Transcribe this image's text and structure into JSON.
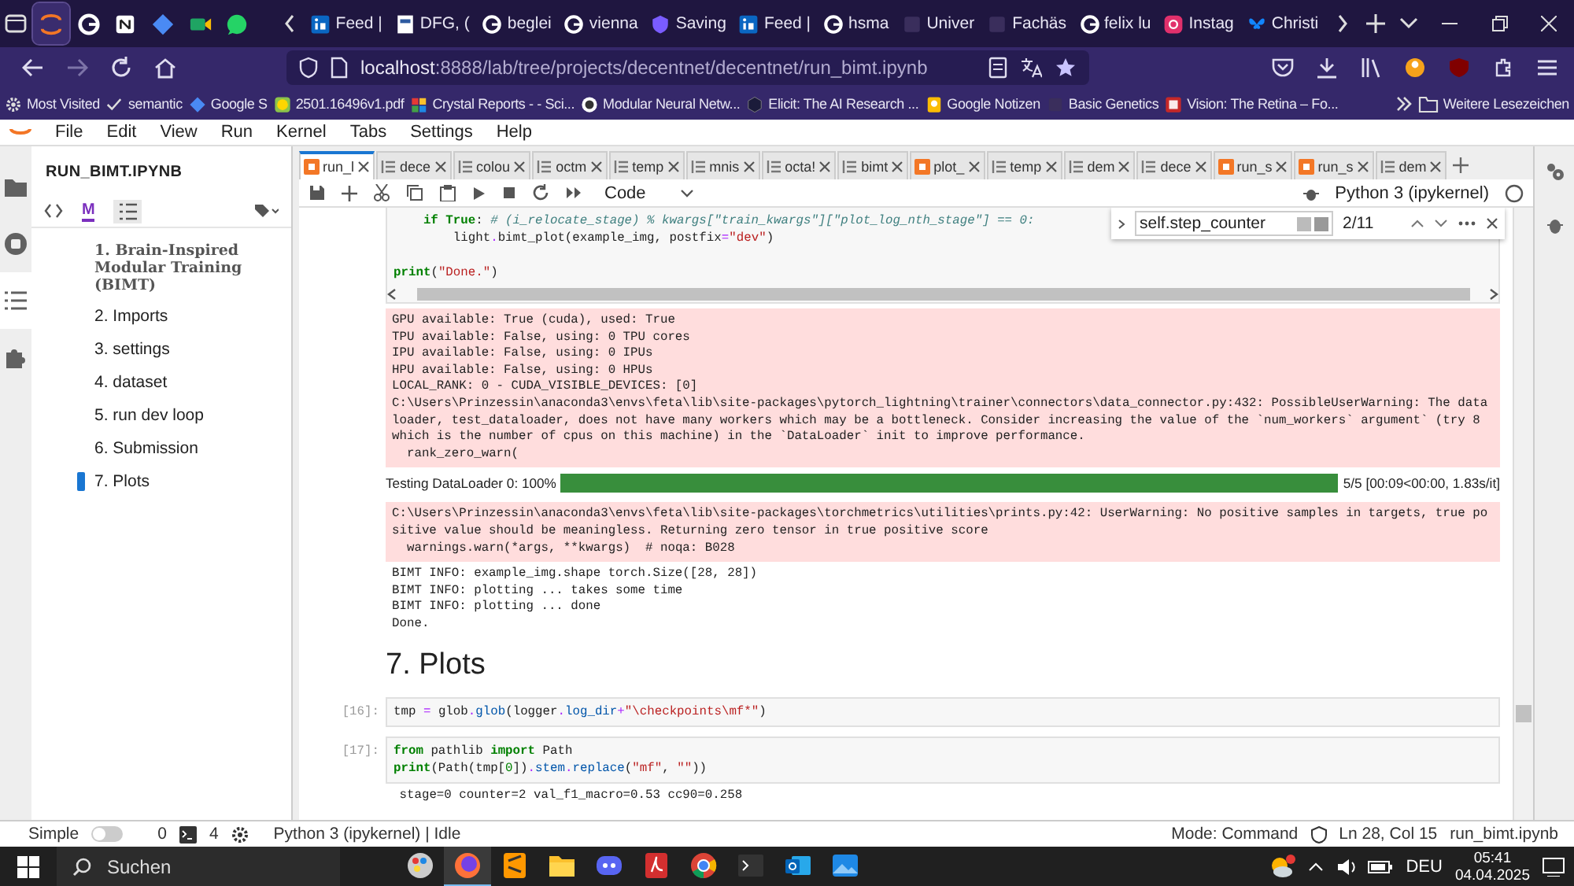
{
  "browser": {
    "pinned_tabs": [
      {
        "kind": "jupyter",
        "selected": true
      },
      {
        "kind": "google",
        "selected": false
      },
      {
        "kind": "notion",
        "selected": false
      },
      {
        "kind": "diamond",
        "selected": false
      },
      {
        "kind": "meet",
        "selected": false
      },
      {
        "kind": "whatsapp",
        "selected": false
      }
    ],
    "tabs": [
      {
        "label": "Feed |",
        "kind": "linkedin",
        "selected": false
      },
      {
        "label": "DFG, (",
        "kind": "dfg",
        "selected": false
      },
      {
        "label": "beglei",
        "kind": "google",
        "selected": false
      },
      {
        "label": "vienna",
        "kind": "google",
        "selected": false
      },
      {
        "label": "Saving",
        "kind": "stripe",
        "selected": false
      },
      {
        "label": "Feed |",
        "kind": "linkedin",
        "selected": false
      },
      {
        "label": "hsma",
        "kind": "google",
        "selected": false
      },
      {
        "label": "Univer",
        "kind": "dark",
        "selected": false
      },
      {
        "label": "Fachäs",
        "kind": "dark",
        "selected": false
      },
      {
        "label": "felix lu",
        "kind": "google",
        "selected": false
      },
      {
        "label": "Instag",
        "kind": "instagram",
        "selected": false
      },
      {
        "label": "Christi",
        "kind": "bluesky",
        "selected": false
      }
    ],
    "url": {
      "host": "localhost",
      "path": ":8888/lab/tree/projects/decentnet/decentnet/run_bimt.ipynb"
    },
    "bookmarks": [
      {
        "label": "Most Visited",
        "kind": "gear"
      },
      {
        "label": "semantic",
        "kind": "check"
      },
      {
        "label": "Google S",
        "kind": "diamond"
      },
      {
        "label": "2501.16496v1.pdf",
        "kind": "smile"
      },
      {
        "label": "Crystal Reports - - Sci...",
        "kind": "crystal"
      },
      {
        "label": "Modular Neural Netw...",
        "kind": "github"
      },
      {
        "label": "Elicit: The AI Research ...",
        "kind": "elicit"
      },
      {
        "label": "Google Notizen",
        "kind": "keep"
      },
      {
        "label": "Basic Genetics",
        "kind": "dark"
      },
      {
        "label": "Vision: The Retina – Fo...",
        "kind": "pb"
      }
    ],
    "bookmarks_more": "Weitere Lesezeichen"
  },
  "jupyter": {
    "menu": [
      "File",
      "Edit",
      "View",
      "Run",
      "Kernel",
      "Tabs",
      "Settings",
      "Help"
    ],
    "activity_bar": [
      {
        "kind": "folder",
        "selected": false
      },
      {
        "kind": "running",
        "selected": false
      },
      {
        "kind": "toc",
        "selected": true
      },
      {
        "kind": "extension",
        "selected": false
      }
    ],
    "sidebar": {
      "title": "RUN_BIMT.IPYNB",
      "markdown_toggle": "M",
      "toc": [
        {
          "label": "1. Brain-Inspired Modular Training (BIMT)",
          "bold": true,
          "selected": false
        },
        {
          "label": "2. Imports",
          "bold": false,
          "selected": false
        },
        {
          "label": "3. settings",
          "bold": false,
          "selected": false
        },
        {
          "label": "4. dataset",
          "bold": false,
          "selected": false
        },
        {
          "label": "5. run dev loop",
          "bold": false,
          "selected": false
        },
        {
          "label": "6. Submission",
          "bold": false,
          "selected": false
        },
        {
          "label": "7. Plots",
          "bold": false,
          "selected": true
        }
      ]
    },
    "tabs": [
      {
        "label": "run_l",
        "kind": "notebook",
        "selected": true
      },
      {
        "label": "dece",
        "kind": "file",
        "selected": false
      },
      {
        "label": "colou",
        "kind": "file",
        "selected": false
      },
      {
        "label": "octm",
        "kind": "file",
        "selected": false
      },
      {
        "label": "temp",
        "kind": "file",
        "selected": false
      },
      {
        "label": "mnis",
        "kind": "file",
        "selected": false
      },
      {
        "label": "octa!",
        "kind": "file",
        "selected": false
      },
      {
        "label": "bimt",
        "kind": "file",
        "selected": false
      },
      {
        "label": "plot_",
        "kind": "notebook",
        "selected": false
      },
      {
        "label": "temp",
        "kind": "file",
        "selected": false
      },
      {
        "label": "dem",
        "kind": "file",
        "selected": false
      },
      {
        "label": "dece",
        "kind": "file",
        "selected": false
      },
      {
        "label": "run_s",
        "kind": "notebook",
        "selected": false
      },
      {
        "label": "run_s",
        "kind": "notebook",
        "selected": false
      },
      {
        "label": "dem",
        "kind": "file",
        "selected": false
      }
    ],
    "cell_type": "Code",
    "kernel": "Python 3 (ipykernel)",
    "find": {
      "value": "self.step_counter",
      "count": "2/11"
    },
    "cells": [
      {
        "kind": "code",
        "blocks": [
          {
            "lines": [
              {
                "tokens": [
                  {
                    "kind": "keyword",
                    "text": "    if True"
                  },
                  {
                    "kind": "plain",
                    "text": ": "
                  },
                  {
                    "kind": "comment",
                    "text": "# (i_relocate_stage) % kwargs[\"train_kwargs\"][\"plot_log_nth_stage\"] == 0:"
                  }
                ]
              },
              {
                "tokens": [
                  {
                    "kind": "plain",
                    "text": "        light"
                  },
                  {
                    "kind": "operator",
                    "text": "."
                  },
                  {
                    "kind": "plain",
                    "text": "bimt_plot(example_img, postfix"
                  },
                  {
                    "kind": "operator",
                    "text": "="
                  },
                  {
                    "kind": "string",
                    "text": "\"dev\""
                  },
                  {
                    "kind": "plain",
                    "text": ")"
                  }
                ]
              }
            ]
          },
          {
            "lines": [
              {
                "tokens": [
                  {
                    "kind": "keyword",
                    "text": "print"
                  },
                  {
                    "kind": "plain",
                    "text": "("
                  },
                  {
                    "kind": "string",
                    "text": "\"Done.\""
                  },
                  {
                    "kind": "plain",
                    "text": ")"
                  }
                ]
              }
            ]
          }
        ],
        "outputs": [
          {
            "kind": "stderr",
            "lines": [
              "GPU available: True (cuda), used: True",
              "TPU available: False, using: 0 TPU cores",
              "IPU available: False, using: 0 IPUs",
              "HPU available: False, using: 0 HPUs",
              "LOCAL_RANK: 0 - CUDA_VISIBLE_DEVICES: [0]",
              "C:\\Users\\Prinzessin\\anaconda3\\envs\\feta\\lib\\site-packages\\pytorch_lightning\\trainer\\connectors\\data_connector.py:432: PossibleUserWarning: The dataloader, test_dataloader, does not have many workers which may be a bottleneck. Consider increasing the value of the `num_workers` argument` (try 8 which is the number of cpus on this machine) in the `DataLoader` init to improve performance.",
              "  rank_zero_warn("
            ]
          },
          {
            "kind": "progress",
            "label": "Testing DataLoader 0: 100%",
            "level": 1.0,
            "reading": "5/5 [00:09<00:00, 1.83s/it]"
          },
          {
            "kind": "stderr",
            "lines": [
              "C:\\Users\\Prinzessin\\anaconda3\\envs\\feta\\lib\\site-packages\\torchmetrics\\utilities\\prints.py:42: UserWarning: No positive samples in targets, true positive value should be meaningless. Returning zero tensor in true positive score",
              "  warnings.warn(*args, **kwargs)  # noqa: B028"
            ]
          },
          {
            "kind": "stdout",
            "lines": [
              "BIMT INFO: example_img.shape torch.Size([28, 28])",
              "BIMT INFO: plotting ... takes some time",
              "BIMT INFO: plotting ... done",
              "Done."
            ]
          }
        ]
      },
      {
        "kind": "heading",
        "text": "7. Plots"
      },
      {
        "kind": "code",
        "prompt": "[16]:",
        "blocks": [
          {
            "lines": [
              {
                "tokens": [
                  {
                    "kind": "plain",
                    "text": "tmp "
                  },
                  {
                    "kind": "operator",
                    "text": "="
                  },
                  {
                    "kind": "plain",
                    "text": " glob"
                  },
                  {
                    "kind": "operator",
                    "text": "."
                  },
                  {
                    "kind": "name",
                    "text": "glob"
                  },
                  {
                    "kind": "plain",
                    "text": "(logger"
                  },
                  {
                    "kind": "operator",
                    "text": "."
                  },
                  {
                    "kind": "name",
                    "text": "log_dir"
                  },
                  {
                    "kind": "operator",
                    "text": "+"
                  },
                  {
                    "kind": "string",
                    "text": "\"\\checkpoints\\mf*\""
                  },
                  {
                    "kind": "plain",
                    "text": ")"
                  }
                ]
              }
            ]
          }
        ]
      },
      {
        "kind": "code",
        "prompt": "[17]:",
        "blocks": [
          {
            "lines": [
              {
                "tokens": [
                  {
                    "kind": "keyword",
                    "text": "from"
                  },
                  {
                    "kind": "plain",
                    "text": " pathlib "
                  },
                  {
                    "kind": "keyword",
                    "text": "import"
                  },
                  {
                    "kind": "plain",
                    "text": " Path"
                  }
                ]
              },
              {
                "tokens": [
                  {
                    "kind": "keyword",
                    "text": "print"
                  },
                  {
                    "kind": "plain",
                    "text": "(Path(tmp["
                  },
                  {
                    "kind": "number",
                    "text": "0"
                  },
                  {
                    "kind": "plain",
                    "text": "])"
                  },
                  {
                    "kind": "operator",
                    "text": "."
                  },
                  {
                    "kind": "name",
                    "text": "stem"
                  },
                  {
                    "kind": "operator",
                    "text": "."
                  },
                  {
                    "kind": "name",
                    "text": "replace"
                  },
                  {
                    "kind": "plain",
                    "text": "("
                  },
                  {
                    "kind": "string",
                    "text": "\"mf\""
                  },
                  {
                    "kind": "plain",
                    "text": ", "
                  },
                  {
                    "kind": "string",
                    "text": "\"\""
                  },
                  {
                    "kind": "plain",
                    "text": "))"
                  }
                ]
              }
            ]
          }
        ],
        "outputs": [
          {
            "kind": "stdout",
            "lines": [
              " stage=0 counter=2 val_f1_macro=0.53 cc90=0.258"
            ]
          }
        ]
      }
    ],
    "status_bar": {
      "simple_label": "Simple",
      "simple_on": false,
      "terminals": "0",
      "kernels": "4",
      "kernel_status": "Python 3 (ipykernel) | Idle",
      "mode": "Mode: Command",
      "cursor": "Ln 28, Col 15",
      "file": "run_bimt.ipynb"
    }
  },
  "taskbar": {
    "search": "Suchen",
    "apps": [
      {
        "kind": "paint",
        "selected": false
      },
      {
        "kind": "firefox",
        "selected": true
      },
      {
        "kind": "sublime",
        "selected": false
      },
      {
        "kind": "explorer",
        "selected": false
      },
      {
        "kind": "discord",
        "selected": false
      },
      {
        "kind": "acrobat",
        "selected": false
      },
      {
        "kind": "chrome",
        "selected": false
      },
      {
        "kind": "terminal",
        "selected": false
      },
      {
        "kind": "outlook",
        "selected": false
      },
      {
        "kind": "photos",
        "selected": false
      }
    ],
    "language": "DEU",
    "time": "05:41",
    "date": "04.04.2025"
  }
}
